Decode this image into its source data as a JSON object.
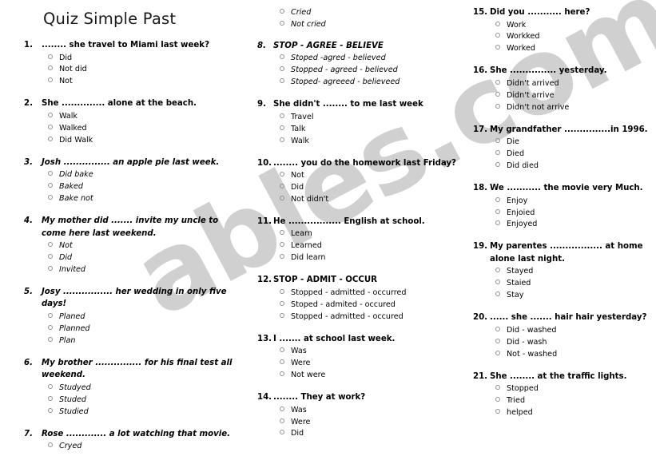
{
  "document": {
    "title": "Quiz Simple Past",
    "watermark": "ables.com",
    "bullet_icon": "hollow-circle-bullet",
    "bullet_color": "#8f8f8f",
    "text_color": "#000000"
  },
  "columns": [
    {
      "id": "column-1",
      "questions": [
        {
          "number": "1.",
          "text": "........ she travel to Miami last week?",
          "italic": false,
          "options": [
            "Did",
            "Not did",
            "Not"
          ]
        },
        {
          "number": "2.",
          "text": "She .............. alone at the beach.",
          "italic": false,
          "options": [
            "Walk",
            "Walked",
            "Did Walk"
          ]
        },
        {
          "number": "3.",
          "text": "Josh ............... an apple pie last week.",
          "italic": true,
          "options": [
            "Did bake",
            "Baked",
            "Bake not"
          ]
        },
        {
          "number": "4.",
          "text": "My mother did ....... invite my uncle to come here last weekend.",
          "italic": true,
          "options": [
            "Not",
            "Did",
            "Invited"
          ]
        },
        {
          "number": "5.",
          "text": "Josy ................ her wedding in only five days!",
          "italic": true,
          "options": [
            "Planed",
            "Planned",
            "Plan"
          ]
        },
        {
          "number": "6.",
          "text": "My brother ............... for his final test all weekend.",
          "italic": true,
          "options": [
            "Studyed",
            "Studed",
            "Studied"
          ]
        },
        {
          "number": "7.",
          "text": "Rose ............. a lot watching that movie.",
          "italic": true,
          "options": [
            "Cryed"
          ]
        }
      ]
    },
    {
      "id": "column-2",
      "continued_options": [
        "Cried",
        "Not cried"
      ],
      "questions": [
        {
          "number": "8.",
          "text": "STOP - AGREE - BELIEVE",
          "italic": true,
          "options": [
            "Stoped -agred - believed",
            "Stopped - agreed - believed",
            "Stoped- agreeed - believeed"
          ]
        },
        {
          "number": "9.",
          "text": "She didn't ........ to me last week",
          "italic": false,
          "options": [
            "Travel",
            "Talk",
            "Walk"
          ]
        },
        {
          "number": "10.",
          "text": "........ you do the homework last Friday?",
          "italic": false,
          "options": [
            "Not",
            "Did",
            "Not didn't"
          ]
        },
        {
          "number": "11.",
          "text": "He ................. English at school.",
          "italic": false,
          "options": [
            "Learn",
            "Learned",
            "Did learn"
          ]
        },
        {
          "number": "12.",
          "text": "STOP - ADMIT - OCCUR",
          "italic": false,
          "options": [
            "Stopped - admitted - occurred",
            "Stoped - admited - occured",
            "Stopped - admitted - occured"
          ]
        },
        {
          "number": "13.",
          "text": "I ....... at school last week.",
          "italic": false,
          "options": [
            "Was",
            "Were",
            "Not were"
          ]
        },
        {
          "number": "14.",
          "text": "........ They at work?",
          "italic": false,
          "options": [
            "Was",
            "Were",
            "Did"
          ]
        }
      ]
    },
    {
      "id": "column-3",
      "questions": [
        {
          "number": "15.",
          "text": "Did you ........... here?",
          "italic": false,
          "options": [
            "Work",
            "Workked",
            "Worked"
          ]
        },
        {
          "number": "16.",
          "text": "She ...............  yesterday.",
          "italic": false,
          "options": [
            "Didn't arrived",
            "Didn't arrive",
            "Didn't not arrive"
          ]
        },
        {
          "number": "17.",
          "text": "My grandfather ...............in 1996.",
          "italic": false,
          "options": [
            "Die",
            "Died",
            "Did died"
          ]
        },
        {
          "number": "18.",
          "text": "We ........... the movie very Much.",
          "italic": false,
          "options": [
            "Enjoy",
            "Enjoied",
            "Enjoyed"
          ]
        },
        {
          "number": "19.",
          "text": "My parentes ................. at home alone last night.",
          "italic": false,
          "options": [
            "Stayed",
            "Staied",
            "Stay"
          ]
        },
        {
          "number": "20.",
          "text": "...... she ....... hair hair yesterday?",
          "italic": false,
          "options": [
            "Did - washed",
            "Did - wash",
            "Not - washed"
          ]
        },
        {
          "number": "21.",
          "text": "She ........ at the traffic lights.",
          "italic": false,
          "options": [
            "Stopped",
            "Tried",
            "helped"
          ]
        }
      ]
    }
  ]
}
